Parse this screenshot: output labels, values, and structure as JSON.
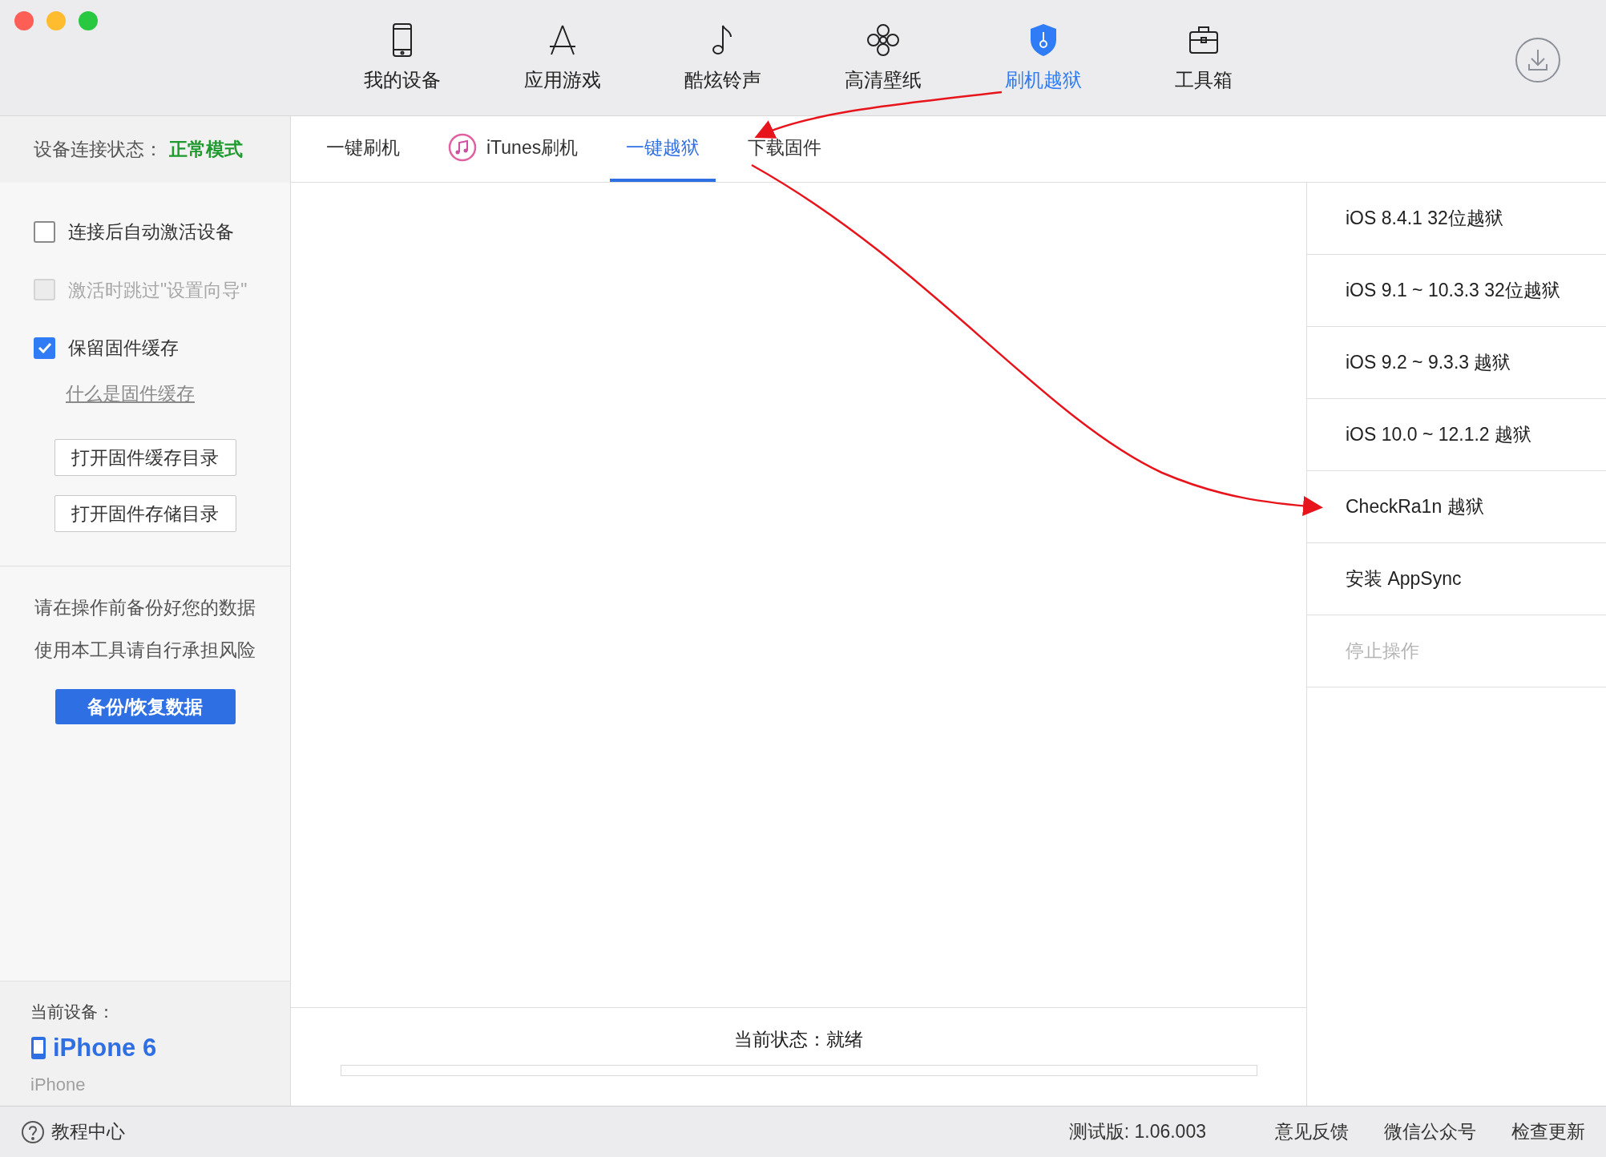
{
  "nav": [
    {
      "label": "我的设备",
      "selected": false
    },
    {
      "label": "应用游戏",
      "selected": false
    },
    {
      "label": "酷炫铃声",
      "selected": false
    },
    {
      "label": "高清壁纸",
      "selected": false
    },
    {
      "label": "刷机越狱",
      "selected": true
    },
    {
      "label": "工具箱",
      "selected": false
    }
  ],
  "sidebar": {
    "connection": {
      "label": "设备连接状态：",
      "value": "正常模式"
    },
    "options": [
      {
        "label": "连接后自动激活设备",
        "checked": false,
        "disabled": false
      },
      {
        "label": "激活时跳过\"设置向导\"",
        "checked": false,
        "disabled": true
      },
      {
        "label": "保留固件缓存",
        "checked": true,
        "disabled": false
      }
    ],
    "link": "什么是固件缓存",
    "buttons": [
      "打开固件缓存目录",
      "打开固件存储目录"
    ],
    "notice": [
      "请在操作前备份好您的数据",
      "使用本工具请自行承担风险"
    ],
    "backup_button": "备份/恢复数据",
    "device": {
      "label": "当前设备：",
      "name": "iPhone 6",
      "model": "iPhone"
    }
  },
  "tabs": [
    {
      "label": "一键刷机",
      "selected": false
    },
    {
      "label": "iTunes刷机",
      "selected": false
    },
    {
      "label": "一键越狱",
      "selected": true
    },
    {
      "label": "下载固件",
      "selected": false
    }
  ],
  "jailbreak_menu": [
    {
      "label": "iOS 8.4.1 32位越狱",
      "disabled": false
    },
    {
      "label": "iOS 9.1 ~ 10.3.3 32位越狱",
      "disabled": false
    },
    {
      "label": "iOS 9.2 ~ 9.3.3 越狱",
      "disabled": false
    },
    {
      "label": "iOS 10.0 ~ 12.1.2 越狱",
      "disabled": false
    },
    {
      "label": "CheckRa1n 越狱",
      "disabled": false
    },
    {
      "label": "安装 AppSync",
      "disabled": false
    },
    {
      "label": "停止操作",
      "disabled": true
    }
  ],
  "status": {
    "label": "当前状态：就绪",
    "level": 0
  },
  "footer": {
    "help": "教程中心",
    "version": "测试版: 1.06.003",
    "links": [
      "意见反馈",
      "微信公众号",
      "检查更新"
    ]
  }
}
